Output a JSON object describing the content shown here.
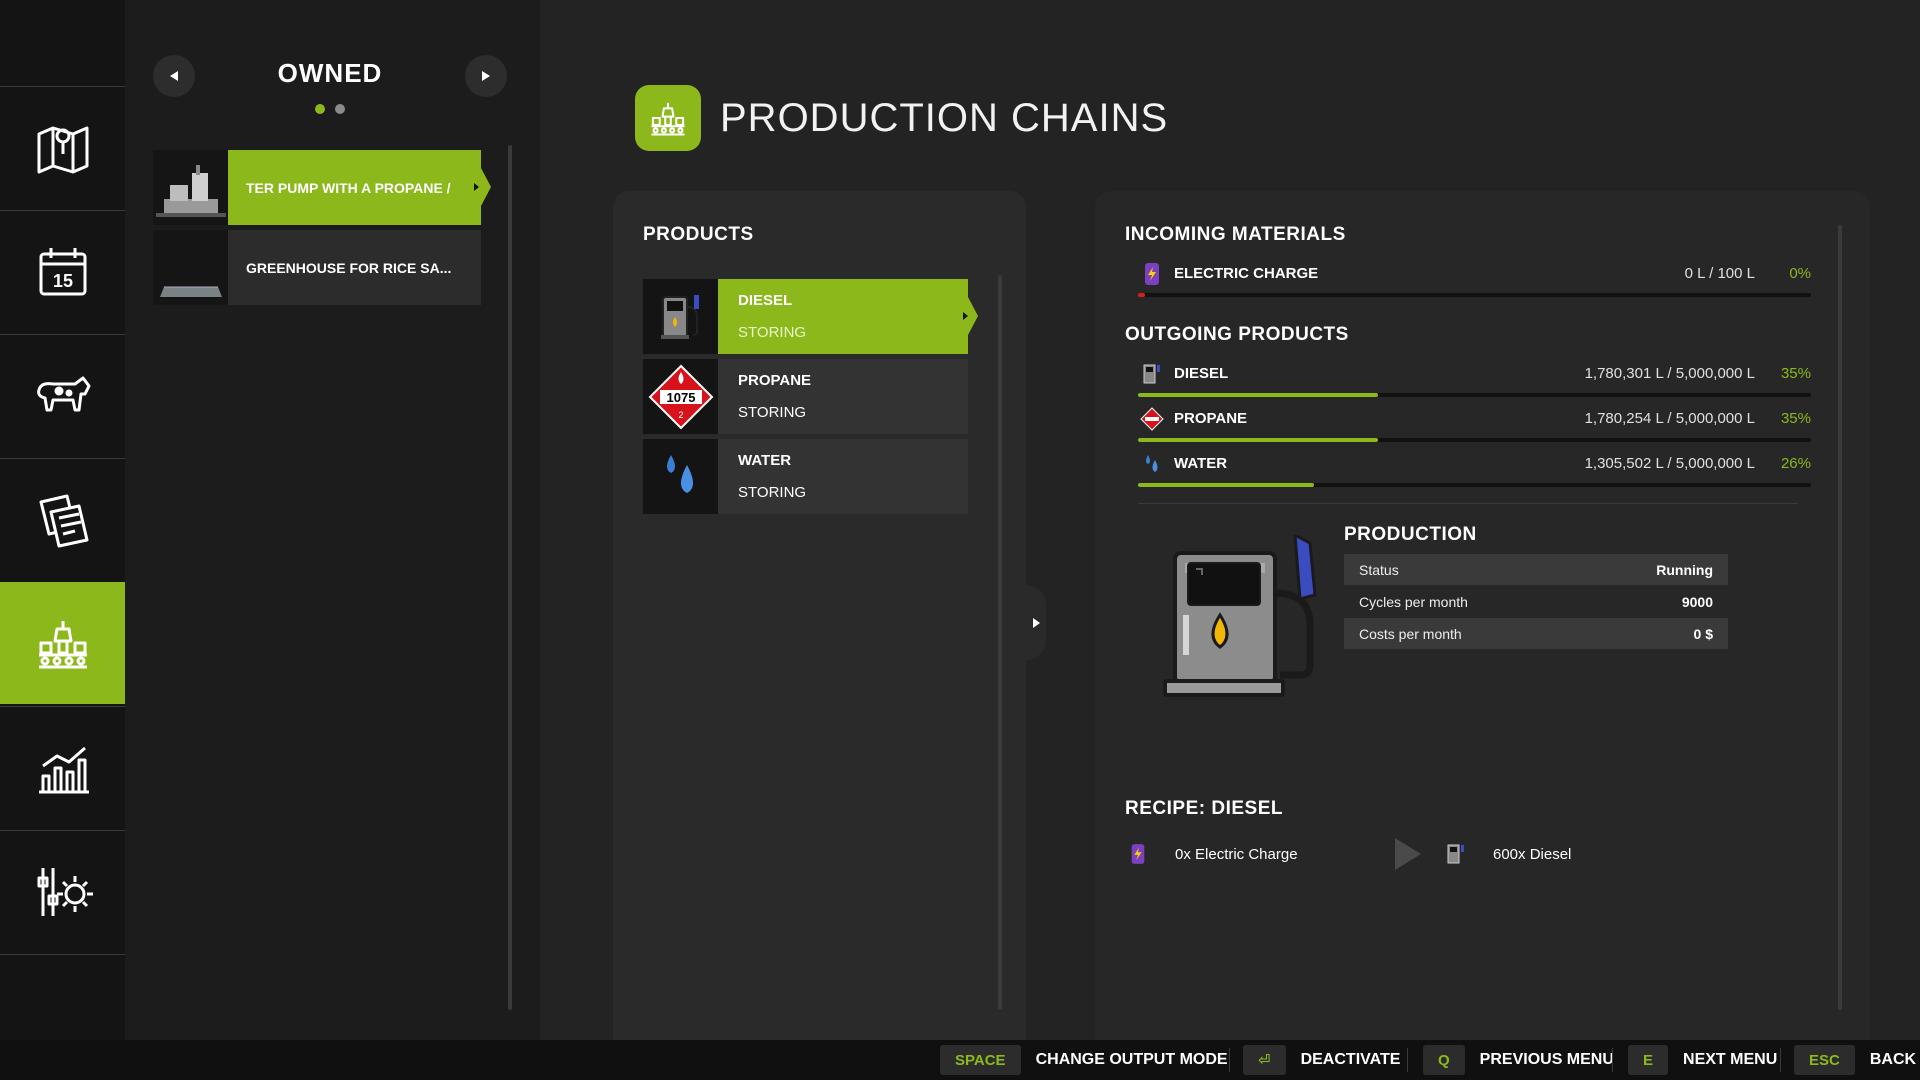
{
  "owned": {
    "title": "OWNED",
    "page_dots": 2,
    "active_page": 1,
    "items": [
      {
        "label": "TER PUMP WITH A PROPANE /",
        "selected": true
      },
      {
        "label": "GREENHOUSE FOR RICE SA...",
        "selected": false
      }
    ]
  },
  "page": {
    "title": "PRODUCTION CHAINS"
  },
  "products": {
    "heading": "PRODUCTS",
    "items": [
      {
        "name": "DIESEL",
        "mode": "STORING",
        "icon": "diesel-pump-icon",
        "selected": true
      },
      {
        "name": "PROPANE",
        "mode": "STORING",
        "icon": "propane-hazard-icon",
        "hazard_number": "1075",
        "hazard_class": "2",
        "selected": false
      },
      {
        "name": "WATER",
        "mode": "STORING",
        "icon": "water-drops-icon",
        "selected": false
      }
    ]
  },
  "incoming": {
    "heading": "INCOMING MATERIALS",
    "items": [
      {
        "name": "ELECTRIC CHARGE",
        "amount": "0 L / 100 L",
        "percent": "0%",
        "fill_fraction": 0.01,
        "icon": "electric-charge-icon"
      }
    ]
  },
  "outgoing": {
    "heading": "OUTGOING PRODUCTS",
    "items": [
      {
        "name": "DIESEL",
        "amount": "1,780,301 L / 5,000,000 L",
        "percent": "35%",
        "fill_fraction": 0.356,
        "icon": "diesel-icon"
      },
      {
        "name": "PROPANE",
        "amount": "1,780,254 L / 5,000,000 L",
        "percent": "35%",
        "fill_fraction": 0.356,
        "icon": "propane-icon"
      },
      {
        "name": "WATER",
        "amount": "1,305,502 L / 5,000,000 L",
        "percent": "26%",
        "fill_fraction": 0.261,
        "icon": "water-icon"
      }
    ]
  },
  "production": {
    "heading": "PRODUCTION",
    "stats": [
      {
        "label": "Status",
        "value": "Running"
      },
      {
        "label": "Cycles per month",
        "value": "9000"
      },
      {
        "label": "Costs per month",
        "value": "0 $"
      }
    ]
  },
  "recipe": {
    "heading": "RECIPE: DIESEL",
    "input": "0x Electric Charge",
    "output": "600x Diesel"
  },
  "bottom_bar": [
    {
      "key": "SPACE",
      "action": "CHANGE OUTPUT MODE"
    },
    {
      "key": "⏎",
      "action": "DEACTIVATE"
    },
    {
      "key": "Q",
      "action": "PREVIOUS MENU"
    },
    {
      "key": "E",
      "action": "NEXT MENU"
    },
    {
      "key": "ESC",
      "action": "BACK"
    }
  ],
  "colors": {
    "accent": "#8cb81c",
    "panel": "#2a2a2a",
    "nav_bg": "#141414",
    "warning": "#d42020"
  }
}
